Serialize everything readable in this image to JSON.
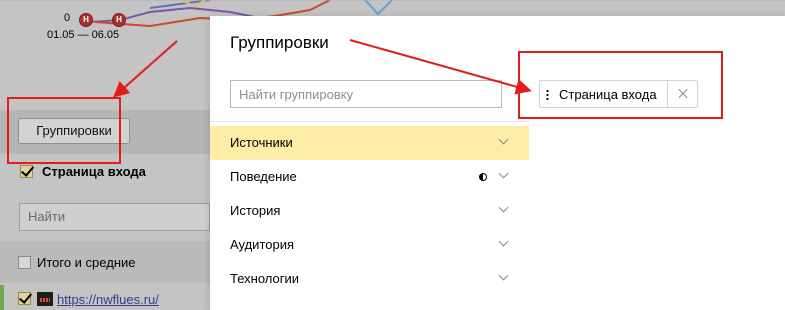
{
  "background": {
    "chart": {
      "zero_label": "0",
      "date_range": "01.05 — 06.05",
      "marker_text": "Н"
    },
    "groupings_button_label": "Группировки",
    "entry_page_label": "Страница входа",
    "search_placeholder": "Найти",
    "totals_label": "Итого и средние",
    "site_link": "https://nwflues.ru/"
  },
  "modal": {
    "title": "Группировки",
    "search_placeholder": "Найти группировку",
    "menu": [
      {
        "label": "Источники",
        "active": true
      },
      {
        "label": "Поведение",
        "active": false,
        "has_partial_icon": true
      },
      {
        "label": "История",
        "active": false
      },
      {
        "label": "Аудитория",
        "active": false
      },
      {
        "label": "Технологии",
        "active": false
      }
    ],
    "selected_chip": {
      "label": "Страница входа"
    }
  },
  "annotation_color": "#e31b1b",
  "active_color": "#fdeda6",
  "icons": [
    "chevron-down-icon",
    "half-circle-icon",
    "drag-handle-icon",
    "close-icon",
    "checkbox-icon",
    "favicon-icon"
  ]
}
